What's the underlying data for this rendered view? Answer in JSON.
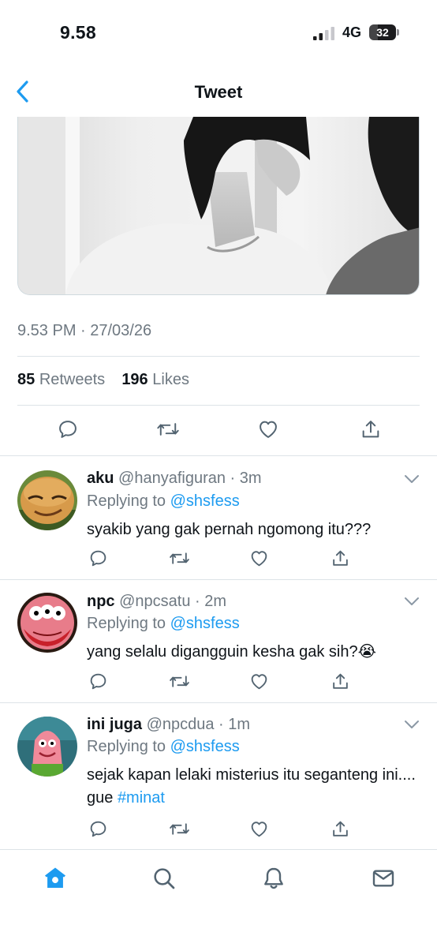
{
  "status_bar": {
    "time": "9.58",
    "network": "4G",
    "battery": "32",
    "battery_level": 0.32
  },
  "nav": {
    "title": "Tweet",
    "back_icon": "chevron-left-icon"
  },
  "tweet": {
    "timestamp": "9.53 PM · 27/03/26",
    "retweets_count": "85",
    "retweets_label": "Retweets",
    "likes_count": "196",
    "likes_label": "Likes",
    "actions": [
      "reply-icon",
      "retweet-icon",
      "like-icon",
      "share-icon"
    ]
  },
  "replies": [
    {
      "name": "aku",
      "handle": "@hanyafiguran",
      "time": "· 3m",
      "replying_prefix": "Replying to",
      "replying_to": "@shsfess",
      "text": "syakib yang gak pernah ngomong itu???",
      "text_tag": ""
    },
    {
      "name": "npc",
      "handle": "@npcsatu",
      "time": "· 2m",
      "replying_prefix": "Replying to",
      "replying_to": "@shsfess",
      "text": "yang selalu digangguin kesha gak sih?😭",
      "text_tag": ""
    },
    {
      "name": "ini juga",
      "handle": "@npcdua",
      "time": "· 1m",
      "replying_prefix": "Replying to",
      "replying_to": "@shsfess",
      "text": "sejak kapan lelaki misterius itu seganteng ini.... gue ",
      "text_tag": "#minat"
    }
  ],
  "tab_bar": [
    "home-icon",
    "search-icon",
    "notifications-icon",
    "messages-icon"
  ],
  "colors": {
    "accent": "#1d9bf0",
    "secondary_text": "#6e7881",
    "divider": "#dde3e7"
  }
}
